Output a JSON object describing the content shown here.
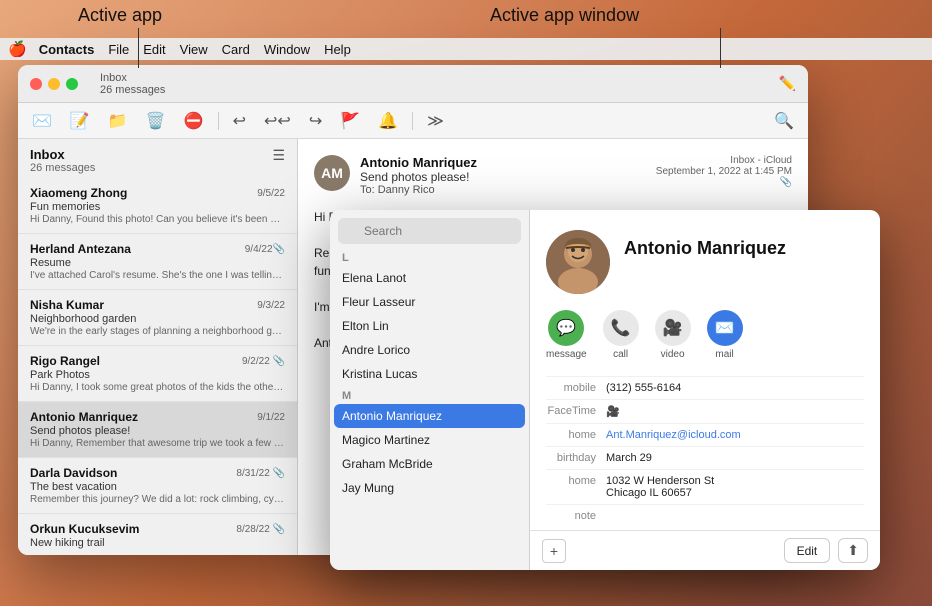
{
  "annotations": {
    "active_app_label": "Active app",
    "active_app_window_label": "Active app window"
  },
  "menubar": {
    "apple_icon": "🍎",
    "items": [
      {
        "label": "Contacts",
        "active": true
      },
      {
        "label": "File"
      },
      {
        "label": "Edit"
      },
      {
        "label": "View"
      },
      {
        "label": "Card"
      },
      {
        "label": "Window"
      },
      {
        "label": "Help"
      }
    ]
  },
  "mail_window": {
    "titlebar": {
      "inbox_label": "Inbox",
      "message_count": "26 messages"
    },
    "mail_list": [
      {
        "sender": "Xiaomeng Zhong",
        "date": "9/5/22",
        "subject": "Fun memories",
        "preview": "Hi Danny, Found this photo! Can you believe it's been years? Let's start planning our next adventure (or at least...",
        "has_attachment": false,
        "selected": false
      },
      {
        "sender": "Herland Antezana",
        "date": "9/4/22",
        "subject": "Resume",
        "preview": "I've attached Carol's resume. She's the one I was telling you about. She may not have quite as much experience as you...",
        "has_attachment": true,
        "selected": false
      },
      {
        "sender": "Nisha Kumar",
        "date": "9/3/22",
        "subject": "Neighborhood garden",
        "preview": "We're in the early stages of planning a neighborhood garden. Each family would be in charge of a plot. Bring yo...",
        "has_attachment": false,
        "selected": false
      },
      {
        "sender": "Rigo Rangel",
        "date": "9/2/22",
        "subject": "Park Photos",
        "preview": "Hi Danny, I took some great photos of the kids the other day. Check out that smile!",
        "has_attachment": true,
        "selected": false
      },
      {
        "sender": "Antonio Manriquez",
        "date": "9/1/22",
        "subject": "Send photos please!",
        "preview": "Hi Danny, Remember that awesome trip we took a few years ago? I found this picture, and thought about all your fun r...",
        "has_attachment": false,
        "selected": true
      },
      {
        "sender": "Darla Davidson",
        "date": "8/31/22",
        "subject": "The best vacation",
        "preview": "Remember this journey? We did a lot: rock climbing, cycling, hiking, and more. This vacation was amazing. An...",
        "has_attachment": true,
        "selected": false
      },
      {
        "sender": "Orkun Kucuksevim",
        "date": "8/28/22",
        "subject": "New hiking trail",
        "preview": "",
        "has_attachment": true,
        "selected": false
      }
    ],
    "content": {
      "sender_name": "Antonio Manriquez",
      "subject": "Send photos please!",
      "inbox_label": "Inbox - iCloud",
      "date": "September 1, 2022 at 1:45 PM",
      "to": "To: Danny Rico",
      "body_lines": [
        "Hi Danny,",
        "",
        "Remember that awe...",
        "fun road trip games :)",
        "",
        "I'm dreaming of wher...",
        "",
        "Antonio"
      ]
    }
  },
  "contacts_window": {
    "search_placeholder": "Search",
    "sections": [
      {
        "label": "L",
        "contacts": [
          {
            "name": "Elena Lanot",
            "selected": false
          },
          {
            "name": "Fleur Lasseur",
            "selected": false
          },
          {
            "name": "Elton Lin",
            "selected": false
          },
          {
            "name": "Andre Lorico",
            "selected": false
          },
          {
            "name": "Kristina Lucas",
            "selected": false
          }
        ]
      },
      {
        "label": "M",
        "contacts": [
          {
            "name": "Antonio Manriquez",
            "selected": true
          },
          {
            "name": "Magico Martinez",
            "selected": false
          },
          {
            "name": "Graham McBride",
            "selected": false
          },
          {
            "name": "Jay Mung",
            "selected": false
          }
        ]
      }
    ],
    "detail": {
      "name": "Antonio Manriquez",
      "actions": [
        {
          "label": "message",
          "icon": "💬",
          "style": "icon-message"
        },
        {
          "label": "call",
          "icon": "📞",
          "style": "icon-call"
        },
        {
          "label": "video",
          "icon": "📷",
          "style": "icon-video"
        },
        {
          "label": "mail",
          "icon": "✉️",
          "style": "icon-mail"
        }
      ],
      "fields": [
        {
          "label": "mobile",
          "value": "(312) 555-6164",
          "type": "normal"
        },
        {
          "label": "FaceTime",
          "value": "📷",
          "type": "icon"
        },
        {
          "label": "home",
          "value": "Ant.Manriquez@icloud.com",
          "type": "link"
        },
        {
          "label": "birthday",
          "value": "March 29",
          "type": "normal"
        },
        {
          "label": "home",
          "value": "1032 W Henderson St\nChicago IL 60657",
          "type": "normal"
        },
        {
          "label": "note",
          "value": "",
          "type": "normal"
        }
      ]
    },
    "buttons": {
      "add": "+",
      "edit": "Edit",
      "share": "⬆"
    }
  }
}
